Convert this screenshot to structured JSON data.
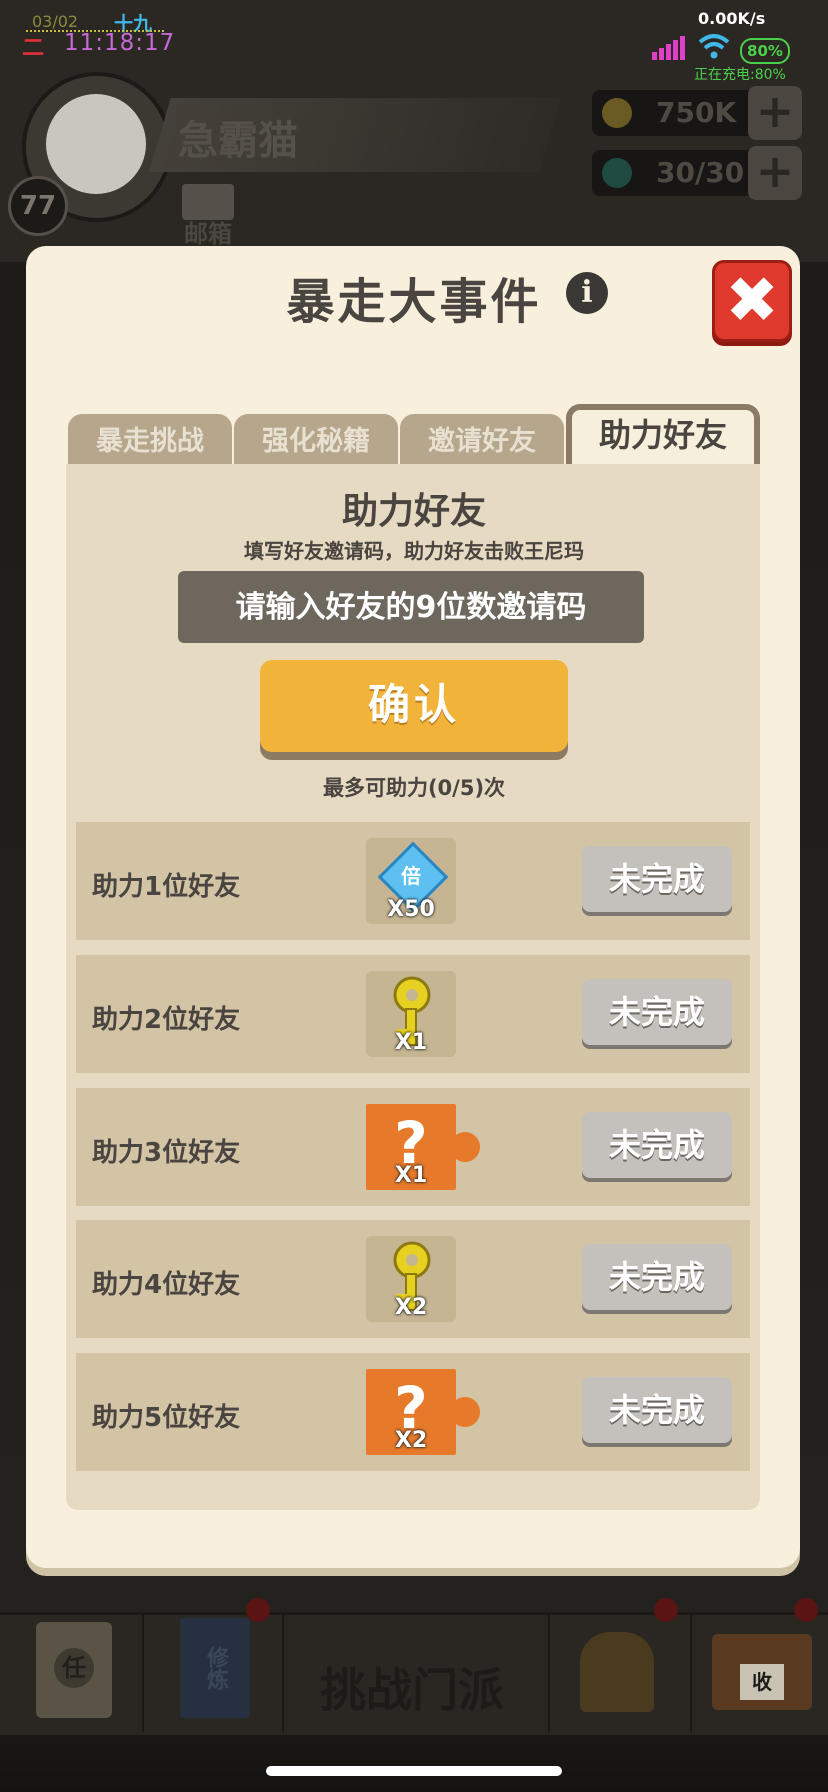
{
  "status_bar": {
    "date": "03/02",
    "lunar_day": "十九",
    "weekday": "二",
    "time": "11:18:17",
    "net_speed": "0.00K/s",
    "battery": "80%",
    "charging": "正在充电:80%"
  },
  "background": {
    "player_name": "急霸猫",
    "level": "77",
    "mail_label": "邮箱",
    "gold": "750K",
    "energy": "30/30",
    "nav_center_label": "挑战门派",
    "nav_task_glyph": "任",
    "nav_book_glyph": "修炼",
    "nav_shop_glyph": "收"
  },
  "modal": {
    "title": "暴走大事件",
    "info_glyph": "i",
    "close_glyph": "✖",
    "tabs": [
      {
        "label": "暴走挑战",
        "active": false
      },
      {
        "label": "强化秘籍",
        "active": false
      },
      {
        "label": "邀请好友",
        "active": false
      },
      {
        "label": "助力好友",
        "active": true
      }
    ],
    "panel": {
      "title": "助力好友",
      "subtitle": "填写好友邀请码，助力好友击败王尼玛",
      "input_placeholder": "请输入好友的9位数邀请码",
      "confirm_label": "确认",
      "help_count": "最多可助力(0/5)次"
    },
    "tasks": [
      {
        "label": "助力1位好友",
        "reward_icon": "multiplier-gem-icon",
        "reward_text": "倍",
        "quantity": "X50",
        "status": "未完成"
      },
      {
        "label": "助力2位好友",
        "reward_icon": "key-icon",
        "quantity": "X1",
        "status": "未完成"
      },
      {
        "label": "助力3位好友",
        "reward_icon": "mystery-puzzle-icon",
        "reward_text": "?",
        "quantity": "X1",
        "status": "未完成"
      },
      {
        "label": "助力4位好友",
        "reward_icon": "key-icon",
        "quantity": "X2",
        "status": "未完成"
      },
      {
        "label": "助力5位好友",
        "reward_icon": "mystery-puzzle-icon",
        "reward_text": "?",
        "quantity": "X2",
        "status": "未完成"
      }
    ]
  },
  "colors": {
    "modal_bg": "#f8f0dc",
    "panel_bg": "#e6dac2",
    "row_bg": "#d3c4a6",
    "confirm": "#f1b33a",
    "close_red": "#e0392d",
    "puzzle_orange": "#e77a2a"
  }
}
